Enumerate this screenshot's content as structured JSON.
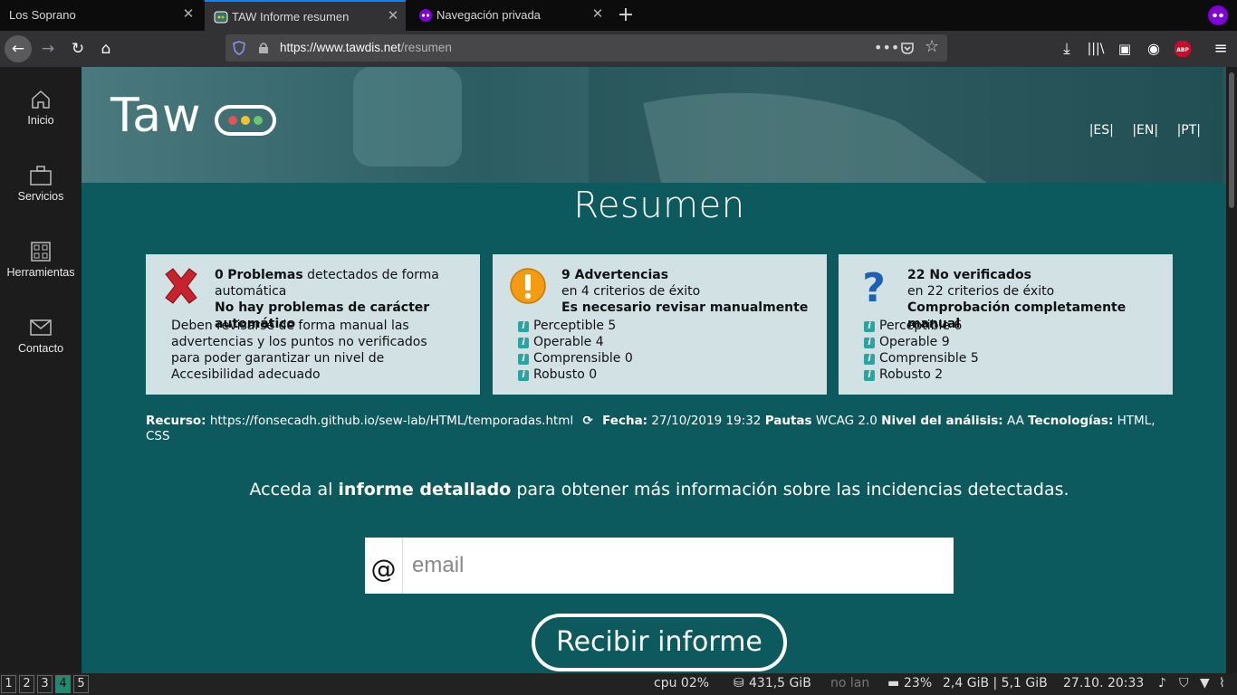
{
  "browser": {
    "tabs": [
      {
        "label": "Los Soprano"
      },
      {
        "label": "TAW Informe resumen"
      },
      {
        "label": "Navegación privada"
      }
    ],
    "url_host": "https://www.tawdis.net",
    "url_path": "/resumen"
  },
  "sidebar": {
    "items": [
      {
        "label": "Inicio",
        "icon": "home-icon"
      },
      {
        "label": "Servicios",
        "icon": "briefcase-icon"
      },
      {
        "label": "Herramientas",
        "icon": "grid-icon"
      },
      {
        "label": "Contacto",
        "icon": "envelope-icon"
      }
    ]
  },
  "header": {
    "logo_text": "Taw",
    "languages": [
      "|ES|",
      "|EN|",
      "|PT|"
    ]
  },
  "page": {
    "title": "Resumen",
    "problems": {
      "count": "0",
      "label": "Problemas",
      "suffix": " detectados de forma automática",
      "note": "No hay problemas de carácter automático",
      "text": "Deben revisarse de forma manual las advertencias y los puntos no verificados para poder garantizar un nivel de Accesibilidad adecuado"
    },
    "warnings": {
      "title": "9 Advertencias",
      "subtitle": "en 4 criterios de éxito",
      "note": "Es necesario revisar manualmente",
      "items": [
        "Perceptible 5",
        "Operable 4",
        "Comprensible 0",
        "Robusto 0"
      ]
    },
    "unverified": {
      "title": "22 No verificados",
      "subtitle": "en 22 criterios de éxito",
      "note": "Comprobación completamente manual",
      "items": [
        "Perceptible 6",
        "Operable 9",
        "Comprensible 5",
        "Robusto 2"
      ]
    },
    "meta": {
      "resource_label": "Recurso:",
      "resource_value": "https://fonsecadh.github.io/sew-lab/HTML/temporadas.html",
      "date_label": "Fecha:",
      "date_value": "27/10/2019 19:32",
      "guidelines_label": "Pautas",
      "guidelines_value": "WCAG 2.0",
      "level_label": "Nivel del análisis:",
      "level_value": "AA",
      "tech_label": "Tecnologías:",
      "tech_value": "HTML, CSS"
    },
    "cta_pre": "Acceda al ",
    "cta_bold": "informe detallado",
    "cta_post": " para obtener más información sobre las incidencias detectadas.",
    "email_at": "@",
    "email_placeholder": "email",
    "send_label": "Recibir informe"
  },
  "taskbar": {
    "workspaces": [
      "1",
      "2",
      "3",
      "4",
      "5"
    ],
    "cpu": "cpu  02%",
    "disk": "431,5 GiB",
    "lan": "no lan",
    "battery": "23%",
    "mem": "2,4 GiB | 5,1 GiB",
    "datetime": "27.10. 20:33"
  },
  "colors": {
    "page_bg": "#0c5a5e",
    "box_bg": "#d2e1e4",
    "accent": "#1f8a70"
  }
}
